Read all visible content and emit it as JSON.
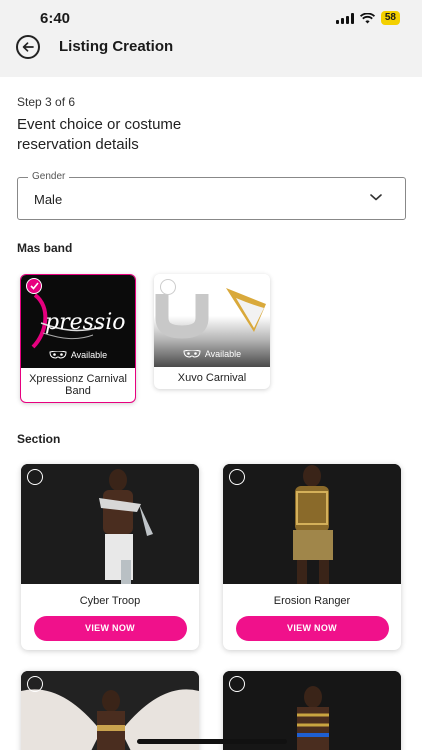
{
  "status_bar": {
    "time": "6:40",
    "battery": "58"
  },
  "header": {
    "title": "Listing Creation"
  },
  "form": {
    "step": "Step 3 of 6",
    "heading": "Event choice or costume reservation details",
    "gender": {
      "label": "Gender",
      "value": "Male"
    },
    "mas_band_label": "Mas band",
    "section_label": "Section"
  },
  "bands": [
    {
      "name": "Xpressionz Carnival Band",
      "logo_text": "xpressio",
      "status": "Available",
      "selected": true
    },
    {
      "name": "Xuvo Carnival",
      "logo_text": "U",
      "status": "Available",
      "selected": false
    }
  ],
  "sections": [
    {
      "name": "Cyber Troop",
      "button": "VIEW NOW"
    },
    {
      "name": "Erosion Ranger",
      "button": "VIEW NOW"
    },
    {
      "name": "",
      "button": ""
    },
    {
      "name": "",
      "button": ""
    }
  ],
  "colors": {
    "accent": "#f0118b",
    "selected_border": "#e7007f",
    "header_bg": "#f2f2f2"
  }
}
